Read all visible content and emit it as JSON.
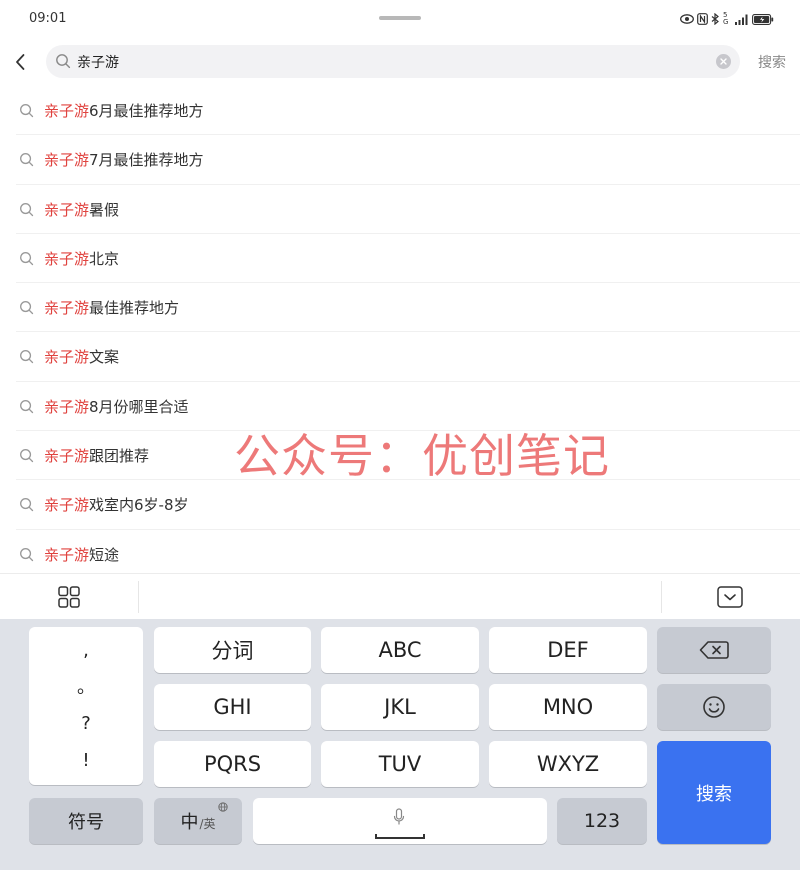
{
  "status_bar": {
    "time": "09:01",
    "network_label": "5G"
  },
  "search": {
    "query": "亲子游",
    "submit_label": "搜索"
  },
  "suggestions": [
    {
      "highlight": "亲子游",
      "rest": "6月最佳推荐地方"
    },
    {
      "highlight": "亲子游",
      "rest": "7月最佳推荐地方"
    },
    {
      "highlight": "亲子游",
      "rest": "暑假"
    },
    {
      "highlight": "亲子游",
      "rest": "北京"
    },
    {
      "highlight": "亲子游",
      "rest": "最佳推荐地方"
    },
    {
      "highlight": "亲子游",
      "rest": "文案"
    },
    {
      "highlight": "亲子游",
      "rest": "8月份哪里合适"
    },
    {
      "highlight": "亲子游",
      "rest": "跟团推荐"
    },
    {
      "highlight": "亲子游",
      "rest": "戏室内6岁-8岁"
    },
    {
      "highlight": "亲子游",
      "rest": "短途"
    }
  ],
  "watermark": "公众号：优创笔记",
  "keyboard": {
    "punct": [
      ",",
      "。",
      "?",
      "!"
    ],
    "row1": [
      "分词",
      "ABC",
      "DEF"
    ],
    "row2": [
      "GHI",
      "JKL",
      "MNO"
    ],
    "row3": [
      "PQRS",
      "TUV",
      "WXYZ"
    ],
    "symbol_label": "符号",
    "lang_main": "中",
    "lang_sub": "/英",
    "num_label": "123",
    "enter_label": "搜索"
  },
  "colors": {
    "highlight": "#e0433f",
    "enter_key": "#3a72f0",
    "watermark": "#ec6e6e"
  }
}
